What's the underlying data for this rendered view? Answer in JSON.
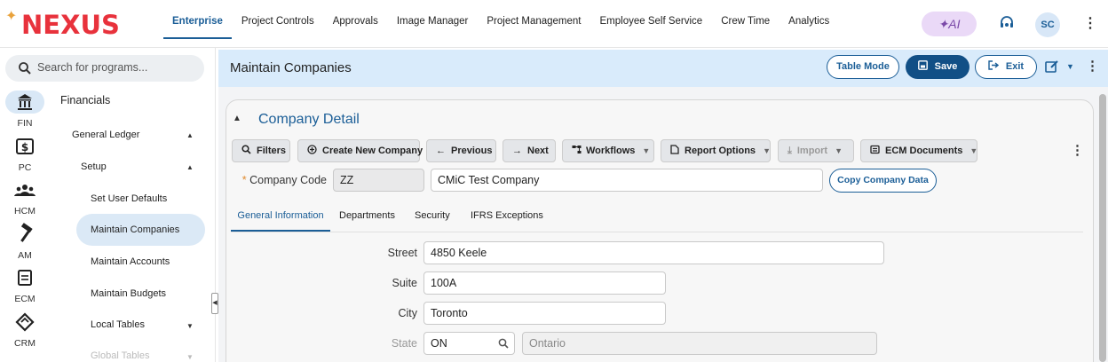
{
  "app": {
    "logo": "NEXUS",
    "logo_spark": "✦"
  },
  "nav": {
    "items": [
      {
        "label": "Enterprise"
      },
      {
        "label": "Project Controls"
      },
      {
        "label": "Approvals"
      },
      {
        "label": "Image Manager"
      },
      {
        "label": "Project Management"
      },
      {
        "label": "Employee Self Service"
      },
      {
        "label": "Crew Time"
      },
      {
        "label": "Analytics"
      }
    ],
    "ai_label": "✦AI",
    "user_initials": "SC"
  },
  "search": {
    "placeholder": "Search for programs..."
  },
  "rail": [
    {
      "label": "FIN",
      "icon": "bank-icon",
      "selected": true
    },
    {
      "label": "PC",
      "icon": "dollar-card-icon"
    },
    {
      "label": "HCM",
      "icon": "people-icon"
    },
    {
      "label": "AM",
      "icon": "hammer-icon"
    },
    {
      "label": "ECM",
      "icon": "document-icon"
    },
    {
      "label": "CRM",
      "icon": "handshake-icon"
    }
  ],
  "menu": {
    "heading": "Financials",
    "general_ledger": "General Ledger",
    "setup": "Setup",
    "items": [
      "Set User Defaults",
      "Maintain Companies",
      "Maintain Accounts",
      "Maintain Budgets"
    ],
    "local_tables": "Local Tables",
    "global_tables": "Global Tables"
  },
  "header": {
    "title": "Maintain Companies",
    "table_mode": "Table Mode",
    "save": "Save",
    "exit": "Exit"
  },
  "card": {
    "title": "Company Detail",
    "toolbar": {
      "filters": "Filters",
      "create": "Create New Company",
      "previous": "Previous",
      "next": "Next",
      "workflows": "Workflows",
      "report_options": "Report Options",
      "import": "Import",
      "ecm_documents": "ECM Documents"
    },
    "company_code_label": "Company Code",
    "company_code": "ZZ",
    "company_name": "CMiC Test Company",
    "copy_button": "Copy Company Data",
    "tabs": [
      "General Information",
      "Departments",
      "Security",
      "IFRS Exceptions"
    ],
    "fields": {
      "street_label": "Street",
      "street": "4850 Keele",
      "suite_label": "Suite",
      "suite": "100A",
      "city_label": "City",
      "city": "Toronto",
      "state_label": "State",
      "state_code": "ON",
      "state_name": "Ontario"
    }
  },
  "colors": {
    "brand_red": "#e8323c",
    "accent_blue": "#1b5e97",
    "band_blue": "#d9ebfb"
  }
}
